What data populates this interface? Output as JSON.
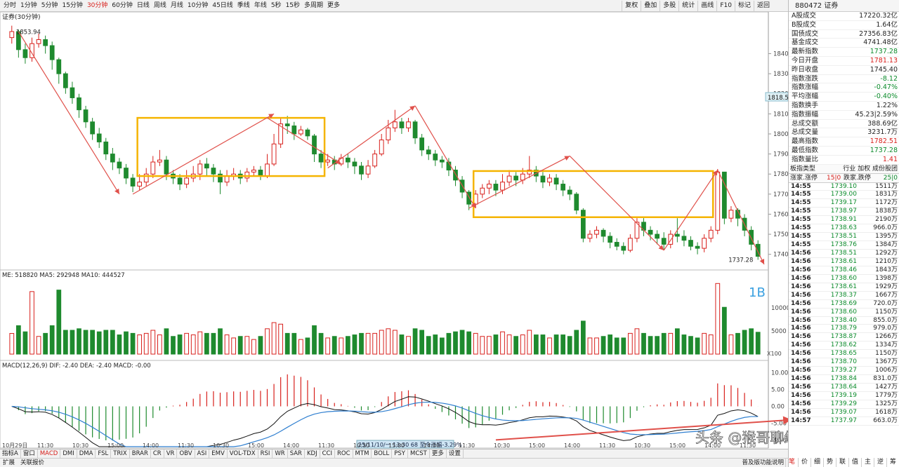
{
  "toolbar": {
    "periods": [
      "分时",
      "1分钟",
      "5分钟",
      "15分钟",
      "30分钟",
      "60分钟",
      "日线",
      "周线",
      "月线",
      "10分钟",
      "45日线",
      "季线",
      "年线",
      "5秒",
      "15秒",
      "多周期",
      "更多"
    ],
    "active_period": "30分钟",
    "tools": [
      "复权",
      "叠加",
      "多股",
      "统计",
      "画线",
      "F10",
      "标记",
      "返回"
    ]
  },
  "chart": {
    "title": "证券(30分钟)",
    "high_label": "1853.94",
    "low_label": "1737.28",
    "current_price_tag": "1818.5",
    "price_ticks": [
      "1840",
      "1830",
      "1820",
      "1810",
      "1800",
      "1790",
      "1780",
      "1770",
      "1760",
      "1750",
      "1740"
    ],
    "volume_legend": "ME: 518820  MA5: 292948  MA10: 444527",
    "volume_ticks": [
      "10000",
      "5000"
    ],
    "volume_unit": "X100",
    "macd_legend": "MACD(12,26,9)  DIF: -2.40  DEA: -2.40  MACD: -0.00",
    "macd_ticks": [
      "10.00",
      "5.00",
      "0.00",
      "-5.00",
      "-10.00"
    ],
    "annotation_1b": "1B",
    "info_bubble": "25/11/10/一 13:30 68 至今涨幅-3.29%",
    "date_labels": [
      "10月29日",
      "11:30",
      "10:30",
      "15:00",
      "14:00",
      "11:30",
      "10:30",
      "15:00",
      "14:00",
      "11:30",
      "10:30",
      "15:00",
      "14:00",
      "11:30",
      "10:30",
      "15:00",
      "14:00",
      "11:30",
      "10:30",
      "15:00",
      "14:00",
      "11:30"
    ],
    "watermark": "头条 @猴哥聊缠论",
    "colors": {
      "up": "#d8201c",
      "down": "#1e8a2e",
      "box": "#f5b400",
      "arrow": "#e0504a",
      "dif": "#111111",
      "dea": "#2f7fd0"
    }
  },
  "chart_data": {
    "type": "candlestick",
    "candles": [
      [
        1848,
        1851,
        1853.94,
        1845
      ],
      [
        1851,
        1842,
        1852,
        1838
      ],
      [
        1842,
        1838,
        1845,
        1835
      ],
      [
        1838,
        1845,
        1848,
        1836
      ],
      [
        1845,
        1847,
        1850,
        1843
      ],
      [
        1847,
        1844,
        1849,
        1840
      ],
      [
        1844,
        1837,
        1846,
        1832
      ],
      [
        1837,
        1830,
        1838,
        1825
      ],
      [
        1830,
        1823,
        1831,
        1820
      ],
      [
        1823,
        1818,
        1826,
        1815
      ],
      [
        1818,
        1812,
        1820,
        1808
      ],
      [
        1812,
        1806,
        1814,
        1803
      ],
      [
        1806,
        1800,
        1808,
        1797
      ],
      [
        1800,
        1796,
        1803,
        1793
      ],
      [
        1796,
        1790,
        1798,
        1787
      ],
      [
        1790,
        1786,
        1793,
        1782
      ],
      [
        1786,
        1783,
        1788,
        1780
      ],
      [
        1783,
        1778,
        1785,
        1775
      ],
      [
        1778,
        1774,
        1780,
        1771
      ],
      [
        1774,
        1776,
        1780,
        1772
      ],
      [
        1776,
        1780,
        1783,
        1774
      ],
      [
        1780,
        1786,
        1789,
        1778
      ],
      [
        1786,
        1787,
        1792,
        1784
      ],
      [
        1787,
        1780,
        1789,
        1777
      ],
      [
        1780,
        1778,
        1782,
        1775
      ],
      [
        1778,
        1775,
        1780,
        1772
      ],
      [
        1775,
        1778,
        1782,
        1773
      ],
      [
        1778,
        1780,
        1784,
        1776
      ],
      [
        1780,
        1785,
        1787,
        1777
      ],
      [
        1785,
        1783,
        1788,
        1779
      ],
      [
        1783,
        1780,
        1785,
        1776
      ],
      [
        1780,
        1776,
        1782,
        1770
      ],
      [
        1776,
        1779,
        1782,
        1774
      ],
      [
        1779,
        1780,
        1783,
        1777
      ],
      [
        1780,
        1778,
        1782,
        1775
      ],
      [
        1778,
        1781,
        1783,
        1776
      ],
      [
        1781,
        1782,
        1784,
        1779
      ],
      [
        1782,
        1779,
        1784,
        1777
      ],
      [
        1779,
        1785,
        1790,
        1778
      ],
      [
        1785,
        1795,
        1800,
        1784
      ],
      [
        1795,
        1805,
        1808,
        1793
      ],
      [
        1805,
        1804,
        1809,
        1800
      ],
      [
        1804,
        1800,
        1806,
        1797
      ],
      [
        1800,
        1802,
        1804,
        1799
      ],
      [
        1802,
        1799,
        1803,
        1797
      ],
      [
        1799,
        1790,
        1800,
        1786
      ],
      [
        1790,
        1786,
        1792,
        1783
      ],
      [
        1786,
        1787,
        1790,
        1784
      ],
      [
        1787,
        1785,
        1789,
        1782
      ],
      [
        1785,
        1788,
        1790,
        1784
      ],
      [
        1788,
        1786,
        1790,
        1783
      ],
      [
        1786,
        1784,
        1788,
        1780
      ],
      [
        1784,
        1780,
        1786,
        1777
      ],
      [
        1780,
        1784,
        1787,
        1778
      ],
      [
        1784,
        1790,
        1792,
        1783
      ],
      [
        1790,
        1797,
        1800,
        1789
      ],
      [
        1797,
        1803,
        1807,
        1795
      ],
      [
        1803,
        1806,
        1812,
        1801
      ],
      [
        1806,
        1803,
        1808,
        1800
      ],
      [
        1803,
        1806,
        1808,
        1801
      ],
      [
        1806,
        1798,
        1807,
        1795
      ],
      [
        1798,
        1792,
        1800,
        1789
      ],
      [
        1792,
        1790,
        1794,
        1787
      ],
      [
        1790,
        1787,
        1792,
        1784
      ],
      [
        1787,
        1786,
        1789,
        1783
      ],
      [
        1786,
        1782,
        1788,
        1779
      ],
      [
        1782,
        1777,
        1784,
        1774
      ],
      [
        1777,
        1771,
        1779,
        1768
      ],
      [
        1771,
        1765,
        1772,
        1762
      ],
      [
        1765,
        1770,
        1772,
        1763
      ],
      [
        1770,
        1773,
        1775,
        1768
      ],
      [
        1773,
        1775,
        1777,
        1770
      ],
      [
        1775,
        1772,
        1777,
        1769
      ],
      [
        1772,
        1776,
        1780,
        1770
      ],
      [
        1776,
        1779,
        1782,
        1774
      ],
      [
        1779,
        1777,
        1781,
        1774
      ],
      [
        1777,
        1780,
        1783,
        1775
      ],
      [
        1780,
        1782,
        1789,
        1778
      ],
      [
        1782,
        1779,
        1784,
        1776
      ],
      [
        1779,
        1776,
        1781,
        1773
      ],
      [
        1776,
        1778,
        1780,
        1774
      ],
      [
        1778,
        1775,
        1780,
        1772
      ],
      [
        1775,
        1772,
        1777,
        1769
      ],
      [
        1772,
        1770,
        1774,
        1767
      ],
      [
        1770,
        1762,
        1771,
        1760
      ],
      [
        1762,
        1748,
        1763,
        1746
      ],
      [
        1748,
        1750,
        1752,
        1746
      ],
      [
        1750,
        1752,
        1754,
        1748
      ],
      [
        1752,
        1749,
        1753,
        1746
      ],
      [
        1749,
        1746,
        1751,
        1743
      ],
      [
        1746,
        1744,
        1748,
        1742
      ],
      [
        1744,
        1742,
        1746,
        1740
      ],
      [
        1742,
        1748,
        1750,
        1741
      ],
      [
        1748,
        1756,
        1758,
        1746
      ],
      [
        1756,
        1752,
        1758,
        1749
      ],
      [
        1752,
        1750,
        1754,
        1747
      ],
      [
        1750,
        1748,
        1752,
        1745
      ],
      [
        1748,
        1745,
        1751,
        1742
      ],
      [
        1745,
        1750,
        1752,
        1743
      ],
      [
        1750,
        1749,
        1758,
        1746
      ],
      [
        1749,
        1747,
        1752,
        1744
      ],
      [
        1747,
        1744,
        1749,
        1742
      ],
      [
        1744,
        1743,
        1746,
        1740
      ],
      [
        1743,
        1748,
        1750,
        1741
      ],
      [
        1748,
        1752,
        1754,
        1746
      ],
      [
        1752,
        1781,
        1782.51,
        1750
      ],
      [
        1781,
        1758,
        1781,
        1755
      ],
      [
        1758,
        1762,
        1764,
        1756
      ],
      [
        1762,
        1758,
        1763,
        1754
      ],
      [
        1758,
        1752,
        1760,
        1749
      ],
      [
        1752,
        1745,
        1754,
        1742
      ],
      [
        1745,
        1739,
        1747,
        1737.28
      ]
    ],
    "ylim": [
      1735,
      1858
    ],
    "volume_ylim": [
      0,
      16000
    ],
    "macd_ylim": [
      -12,
      12
    ]
  },
  "right_panel": {
    "header": "880472 证券",
    "stats": [
      {
        "label": "A股成交",
        "value": "17220.32亿",
        "color": ""
      },
      {
        "label": "B股成交",
        "value": "1.64亿",
        "color": ""
      },
      {
        "label": "国债成交",
        "value": "27356.83亿",
        "color": ""
      },
      {
        "label": "基金成交",
        "value": "4741.48亿",
        "color": ""
      },
      {
        "label": "最新指数",
        "value": "1737.28",
        "color": "green"
      },
      {
        "label": "今日开盘",
        "value": "1781.13",
        "color": "red"
      },
      {
        "label": "昨日收盘",
        "value": "1745.40",
        "color": ""
      },
      {
        "label": "指数涨跌",
        "value": "-8.12",
        "color": "green"
      },
      {
        "label": "指数涨幅",
        "value": "-0.47%",
        "color": "green"
      },
      {
        "label": "平均涨幅",
        "value": "-0.40%",
        "color": "green"
      },
      {
        "label": "指数换手",
        "value": "1.22%",
        "color": ""
      },
      {
        "label": "指数振幅",
        "value": "45.23|2.59%",
        "color": ""
      },
      {
        "label": "总成交额",
        "value": "388.69亿",
        "color": ""
      },
      {
        "label": "总成交量",
        "value": "3231.7万",
        "color": ""
      },
      {
        "label": "最高指数",
        "value": "1782.51",
        "color": "red"
      },
      {
        "label": "最低指数",
        "value": "1737.28",
        "color": "green"
      },
      {
        "label": "指数量比",
        "value": "1.41",
        "color": "red"
      }
    ],
    "type_row": {
      "label": "板指类型",
      "value": "行业 加权 成份股团"
    },
    "updown_row": {
      "a": "涨家.涨停",
      "b": "15|0",
      "c": "跌家.跌停",
      "d": "25|0"
    },
    "ticks": [
      [
        "14:55",
        "1739.10",
        "1511万"
      ],
      [
        "14:55",
        "1739.00",
        "1831万"
      ],
      [
        "14:55",
        "1739.17",
        "1172万"
      ],
      [
        "14:55",
        "1738.97",
        "1838万"
      ],
      [
        "14:55",
        "1738.91",
        "2190万"
      ],
      [
        "14:55",
        "1738.63",
        "966.0万"
      ],
      [
        "14:55",
        "1738.51",
        "1395万"
      ],
      [
        "14:55",
        "1738.76",
        "1384万"
      ],
      [
        "14:56",
        "1738.51",
        "1292万"
      ],
      [
        "14:56",
        "1738.61",
        "1210万"
      ],
      [
        "14:56",
        "1738.46",
        "1843万"
      ],
      [
        "14:56",
        "1738.60",
        "1398万"
      ],
      [
        "14:56",
        "1738.61",
        "1929万"
      ],
      [
        "14:56",
        "1738.37",
        "1667万"
      ],
      [
        "14:56",
        "1738.69",
        "720.0万"
      ],
      [
        "14:56",
        "1738.60",
        "1150万"
      ],
      [
        "14:56",
        "1738.40",
        "855.0万"
      ],
      [
        "14:56",
        "1738.79",
        "979.0万"
      ],
      [
        "14:56",
        "1738.87",
        "1266万"
      ],
      [
        "14:56",
        "1738.62",
        "1334万"
      ],
      [
        "14:56",
        "1738.65",
        "1150万"
      ],
      [
        "14:56",
        "1738.70",
        "1367万"
      ],
      [
        "14:56",
        "1739.27",
        "1006万"
      ],
      [
        "14:56",
        "1738.84",
        "831.0万"
      ],
      [
        "14:56",
        "1738.64",
        "1427万"
      ],
      [
        "14:56",
        "1739.19",
        "1779万"
      ],
      [
        "14:56",
        "1739.29",
        "1325万"
      ],
      [
        "14:56",
        "1739.07",
        "1618万"
      ],
      [
        "14:57",
        "1737.97",
        "663.0万"
      ]
    ],
    "bottom_tabs": [
      "笔",
      "价",
      "细",
      "势",
      "联",
      "值",
      "主",
      "逆",
      "筹"
    ]
  },
  "bottom_tabs": [
    "指标A",
    "窗口",
    "MACD",
    "DMI",
    "DMA",
    "FSL",
    "TRIX",
    "BRAR",
    "CR",
    "VR",
    "OBV",
    "ASI",
    "EMV",
    "VOL-TDX",
    "RSI",
    "WR",
    "SAR",
    "KDJ",
    "CCI",
    "ROC",
    "MTM",
    "BOLL",
    "PSY",
    "MCST",
    "更多",
    "设置"
  ],
  "bottom_row2": [
    "扩展",
    "关联报价"
  ],
  "bottom_row2_right": "普及版功能说明"
}
